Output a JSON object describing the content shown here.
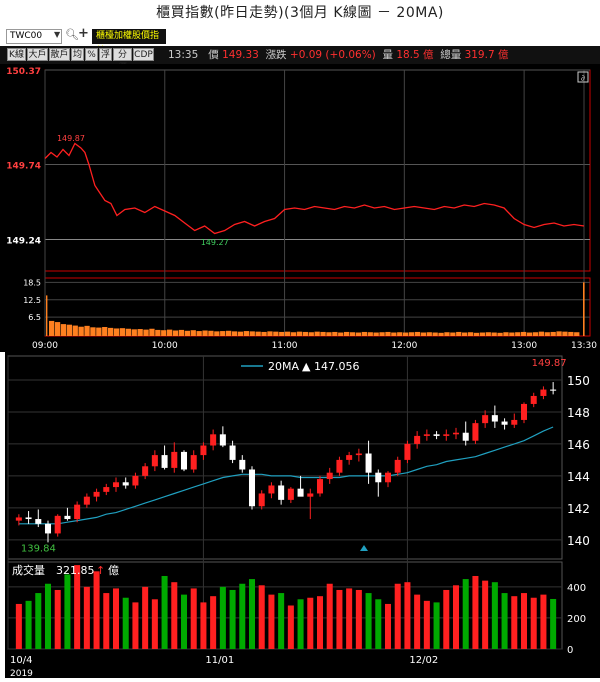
{
  "title": "櫃買指數(昨日走勢)(3個月 K線圖 － 20MA)",
  "toolbar": {
    "symbol": "TWC00",
    "index_name": "櫃檯加權股價指數",
    "buttons": [
      "K線",
      "大戶",
      "散戶",
      "均",
      "%",
      "浮",
      "分價",
      "CDP"
    ],
    "time": "13:35",
    "price_label": "價",
    "price": "149.33",
    "change_label": "漲跌",
    "change": "+0.09 (+0.06%)",
    "volume_label": "量",
    "volume": "18.5 億",
    "total_label": "總量",
    "total": "319.7 億"
  },
  "colors": {
    "up": "#ff2020",
    "down": "#00aa00",
    "ma": "#20a0c0",
    "intraday_line": "#ff2020",
    "grid": "#444444",
    "white_candle": "#ffffff"
  },
  "chart_data": [
    {
      "type": "line",
      "name": "intraday",
      "y_ticks": [
        "150.37",
        "149.74",
        "149.24"
      ],
      "y_tick_values": [
        150.37,
        149.74,
        149.24
      ],
      "ylim": [
        149.03,
        150.37
      ],
      "annotations": [
        {
          "label": "149.87",
          "value": 149.87
        },
        {
          "label": "149.27",
          "value": 149.27
        }
      ],
      "x_ticks": [
        "09:00",
        "10:00",
        "11:00",
        "12:00",
        "13:00",
        "13:30"
      ],
      "x_tick_minutes": [
        0,
        60,
        120,
        180,
        240,
        270
      ],
      "price_minutes": [
        0,
        3,
        6,
        9,
        12,
        15,
        18,
        20,
        22,
        25,
        27,
        30,
        33,
        36,
        40,
        45,
        50,
        55,
        60,
        65,
        70,
        75,
        80,
        85,
        90,
        95,
        100,
        105,
        110,
        115,
        120,
        125,
        130,
        135,
        140,
        145,
        150,
        155,
        160,
        165,
        170,
        175,
        180,
        185,
        190,
        195,
        200,
        205,
        210,
        215,
        220,
        225,
        230,
        235,
        240,
        245,
        250,
        255,
        260,
        265,
        270
      ],
      "price_values": [
        149.78,
        149.82,
        149.79,
        149.84,
        149.8,
        149.88,
        149.85,
        149.82,
        149.74,
        149.6,
        149.56,
        149.5,
        149.48,
        149.4,
        149.44,
        149.45,
        149.42,
        149.46,
        149.43,
        149.4,
        149.35,
        149.3,
        149.33,
        149.28,
        149.3,
        149.34,
        149.36,
        149.33,
        149.36,
        149.38,
        149.44,
        149.45,
        149.44,
        149.46,
        149.45,
        149.44,
        149.46,
        149.45,
        149.47,
        149.45,
        149.46,
        149.44,
        149.45,
        149.46,
        149.45,
        149.44,
        149.46,
        149.45,
        149.47,
        149.46,
        149.48,
        149.47,
        149.45,
        149.38,
        149.34,
        149.32,
        149.34,
        149.35,
        149.33,
        149.34,
        149.33
      ],
      "volume_ticks": [
        "18.5",
        "12.5",
        "6.5"
      ],
      "volume_tick_values": [
        18.5,
        12.5,
        6.5
      ],
      "volume_ylim": [
        0,
        20
      ],
      "volume_first": 14,
      "volume_last": 18.5,
      "volume_values": [
        5.2,
        4.8,
        4.1,
        3.9,
        3.6,
        3.2,
        3.5,
        3.0,
        2.9,
        3.1,
        2.8,
        2.6,
        2.7,
        2.5,
        2.3,
        2.4,
        2.2,
        2.5,
        2.1,
        2.0,
        2.2,
        1.9,
        2.1,
        1.8,
        2.0,
        1.7,
        1.9,
        1.8,
        1.6,
        1.7,
        1.8,
        1.6,
        1.5,
        1.7,
        1.6,
        1.5,
        1.4,
        1.6,
        1.5,
        1.4,
        1.5,
        1.3,
        1.5,
        1.4,
        1.3,
        1.5,
        1.4,
        1.3,
        1.4,
        1.2,
        1.4,
        1.3,
        1.2,
        1.4,
        1.3,
        1.2,
        1.3,
        1.4,
        1.2,
        1.3,
        1.2,
        1.3,
        1.4,
        1.2,
        1.3,
        1.2,
        1.1,
        1.3,
        1.2,
        1.4,
        1.2,
        1.3,
        1.1,
        1.2,
        1.3,
        1.2,
        1.1,
        1.3,
        1.2,
        1.3,
        1.4,
        1.2,
        1.3,
        1.5,
        1.3,
        1.4,
        1.6,
        1.5,
        1.4,
        1.3
      ]
    },
    {
      "type": "candlestick",
      "name": "kline",
      "legend": "20MA",
      "legend_value": "▲ 147.056",
      "y_ticks": [
        "150",
        "148",
        "146",
        "144",
        "142",
        "140"
      ],
      "y_tick_values": [
        150,
        148,
        146,
        144,
        142,
        140
      ],
      "ylim": [
        138.8,
        151.5
      ],
      "high_label": "149.87",
      "low_label": "139.84",
      "x_ticks": [
        "10/4",
        "11/01",
        "12/02"
      ],
      "x_tick_index": [
        0,
        19,
        40
      ],
      "year_label": "2019",
      "volume_title": "成交量",
      "volume_value": "321.85",
      "volume_unit": "億",
      "volume_ticks": [
        "400",
        "200",
        "0"
      ],
      "volume_tick_values": [
        400,
        200,
        0
      ],
      "volume_ylim": [
        0,
        560
      ],
      "candles": [
        {
          "o": 141.2,
          "h": 141.6,
          "l": 140.9,
          "c": 141.4,
          "v": 290
        },
        {
          "o": 141.4,
          "h": 141.8,
          "l": 141.0,
          "c": 141.3,
          "v": 310
        },
        {
          "o": 141.3,
          "h": 141.9,
          "l": 140.8,
          "c": 141.0,
          "v": 360
        },
        {
          "o": 141.0,
          "h": 141.2,
          "l": 139.84,
          "c": 140.4,
          "v": 420
        },
        {
          "o": 140.4,
          "h": 141.6,
          "l": 140.2,
          "c": 141.5,
          "v": 380
        },
        {
          "o": 141.5,
          "h": 142.0,
          "l": 141.2,
          "c": 141.3,
          "v": 480
        },
        {
          "o": 141.3,
          "h": 142.4,
          "l": 141.1,
          "c": 142.2,
          "v": 540
        },
        {
          "o": 142.2,
          "h": 142.9,
          "l": 142.0,
          "c": 142.7,
          "v": 400
        },
        {
          "o": 142.7,
          "h": 143.2,
          "l": 142.4,
          "c": 143.0,
          "v": 500
        },
        {
          "o": 143.0,
          "h": 143.5,
          "l": 142.8,
          "c": 143.3,
          "v": 360
        },
        {
          "o": 143.3,
          "h": 143.9,
          "l": 143.0,
          "c": 143.6,
          "v": 390
        },
        {
          "o": 143.6,
          "h": 143.9,
          "l": 143.2,
          "c": 143.4,
          "v": 330
        },
        {
          "o": 143.4,
          "h": 144.2,
          "l": 143.2,
          "c": 144.0,
          "v": 300
        },
        {
          "o": 144.0,
          "h": 144.8,
          "l": 143.8,
          "c": 144.6,
          "v": 400
        },
        {
          "o": 144.6,
          "h": 145.6,
          "l": 144.3,
          "c": 145.3,
          "v": 320
        },
        {
          "o": 145.3,
          "h": 145.9,
          "l": 144.4,
          "c": 144.5,
          "v": 470
        },
        {
          "o": 144.5,
          "h": 146.1,
          "l": 144.2,
          "c": 145.5,
          "v": 430
        },
        {
          "o": 145.5,
          "h": 145.6,
          "l": 144.3,
          "c": 144.4,
          "v": 350
        },
        {
          "o": 144.4,
          "h": 145.6,
          "l": 144.2,
          "c": 145.3,
          "v": 390
        },
        {
          "o": 145.3,
          "h": 146.1,
          "l": 145.0,
          "c": 145.9,
          "v": 300
        },
        {
          "o": 145.9,
          "h": 146.9,
          "l": 145.6,
          "c": 146.6,
          "v": 340
        },
        {
          "o": 146.6,
          "h": 147.1,
          "l": 145.8,
          "c": 145.9,
          "v": 400
        },
        {
          "o": 145.9,
          "h": 146.2,
          "l": 144.8,
          "c": 145.0,
          "v": 380
        },
        {
          "o": 145.0,
          "h": 145.3,
          "l": 144.2,
          "c": 144.4,
          "v": 420
        },
        {
          "o": 144.4,
          "h": 144.6,
          "l": 141.9,
          "c": 142.1,
          "v": 450
        },
        {
          "o": 142.1,
          "h": 143.1,
          "l": 141.9,
          "c": 142.9,
          "v": 410
        },
        {
          "o": 142.9,
          "h": 143.6,
          "l": 142.6,
          "c": 143.4,
          "v": 350
        },
        {
          "o": 143.4,
          "h": 143.7,
          "l": 142.2,
          "c": 142.5,
          "v": 360
        },
        {
          "o": 142.5,
          "h": 143.3,
          "l": 142.3,
          "c": 143.2,
          "v": 280
        },
        {
          "o": 143.2,
          "h": 144.0,
          "l": 142.9,
          "c": 142.7,
          "v": 320
        },
        {
          "o": 142.7,
          "h": 143.2,
          "l": 141.3,
          "c": 142.9,
          "v": 330
        },
        {
          "o": 142.9,
          "h": 144.0,
          "l": 142.7,
          "c": 143.8,
          "v": 340
        },
        {
          "o": 143.8,
          "h": 144.5,
          "l": 143.5,
          "c": 144.2,
          "v": 420
        },
        {
          "o": 144.2,
          "h": 145.2,
          "l": 144.0,
          "c": 145.0,
          "v": 380
        },
        {
          "o": 145.0,
          "h": 145.5,
          "l": 144.7,
          "c": 145.3,
          "v": 390
        },
        {
          "o": 145.3,
          "h": 145.7,
          "l": 144.9,
          "c": 145.4,
          "v": 380
        },
        {
          "o": 145.4,
          "h": 146.2,
          "l": 143.5,
          "c": 144.2,
          "v": 360
        },
        {
          "o": 144.2,
          "h": 144.4,
          "l": 142.7,
          "c": 143.6,
          "v": 320
        },
        {
          "o": 143.6,
          "h": 144.3,
          "l": 143.3,
          "c": 144.2,
          "v": 290
        },
        {
          "o": 144.2,
          "h": 145.2,
          "l": 144.0,
          "c": 145.0,
          "v": 420
        },
        {
          "o": 145.0,
          "h": 146.2,
          "l": 144.8,
          "c": 146.0,
          "v": 430
        },
        {
          "o": 146.0,
          "h": 146.8,
          "l": 145.7,
          "c": 146.5,
          "v": 350
        },
        {
          "o": 146.5,
          "h": 146.9,
          "l": 146.2,
          "c": 146.6,
          "v": 310
        },
        {
          "o": 146.6,
          "h": 146.8,
          "l": 146.3,
          "c": 146.5,
          "v": 300
        },
        {
          "o": 146.5,
          "h": 146.9,
          "l": 146.2,
          "c": 146.6,
          "v": 380
        },
        {
          "o": 146.6,
          "h": 147.0,
          "l": 146.3,
          "c": 146.7,
          "v": 410
        },
        {
          "o": 146.7,
          "h": 147.4,
          "l": 145.9,
          "c": 146.2,
          "v": 450
        },
        {
          "o": 146.2,
          "h": 147.5,
          "l": 146.0,
          "c": 147.3,
          "v": 470
        },
        {
          "o": 147.3,
          "h": 148.1,
          "l": 147.0,
          "c": 147.8,
          "v": 440
        },
        {
          "o": 147.8,
          "h": 148.4,
          "l": 147.0,
          "c": 147.4,
          "v": 430
        },
        {
          "o": 147.4,
          "h": 147.6,
          "l": 146.9,
          "c": 147.2,
          "v": 360
        },
        {
          "o": 147.2,
          "h": 147.9,
          "l": 147.0,
          "c": 147.5,
          "v": 340
        },
        {
          "o": 147.5,
          "h": 148.6,
          "l": 147.3,
          "c": 148.5,
          "v": 360
        },
        {
          "o": 148.5,
          "h": 149.2,
          "l": 148.3,
          "c": 149.0,
          "v": 330
        },
        {
          "o": 149.0,
          "h": 149.6,
          "l": 148.8,
          "c": 149.4,
          "v": 350
        },
        {
          "o": 149.4,
          "h": 149.87,
          "l": 149.1,
          "c": 149.33,
          "v": 322
        }
      ],
      "ma": [
        141.0,
        141.0,
        141.0,
        141.0,
        141.0,
        141.1,
        141.2,
        141.3,
        141.4,
        141.6,
        141.7,
        141.9,
        142.1,
        142.3,
        142.5,
        142.7,
        142.9,
        143.1,
        143.3,
        143.5,
        143.7,
        143.9,
        144.0,
        144.1,
        144.1,
        144.1,
        144.0,
        144.0,
        144.0,
        143.9,
        143.9,
        143.9,
        143.9,
        143.9,
        144.0,
        144.0,
        144.0,
        144.0,
        144.0,
        144.1,
        144.2,
        144.4,
        144.6,
        144.7,
        144.9,
        145.0,
        145.1,
        145.2,
        145.4,
        145.6,
        145.8,
        146.0,
        146.2,
        146.5,
        146.8,
        147.056
      ]
    }
  ]
}
